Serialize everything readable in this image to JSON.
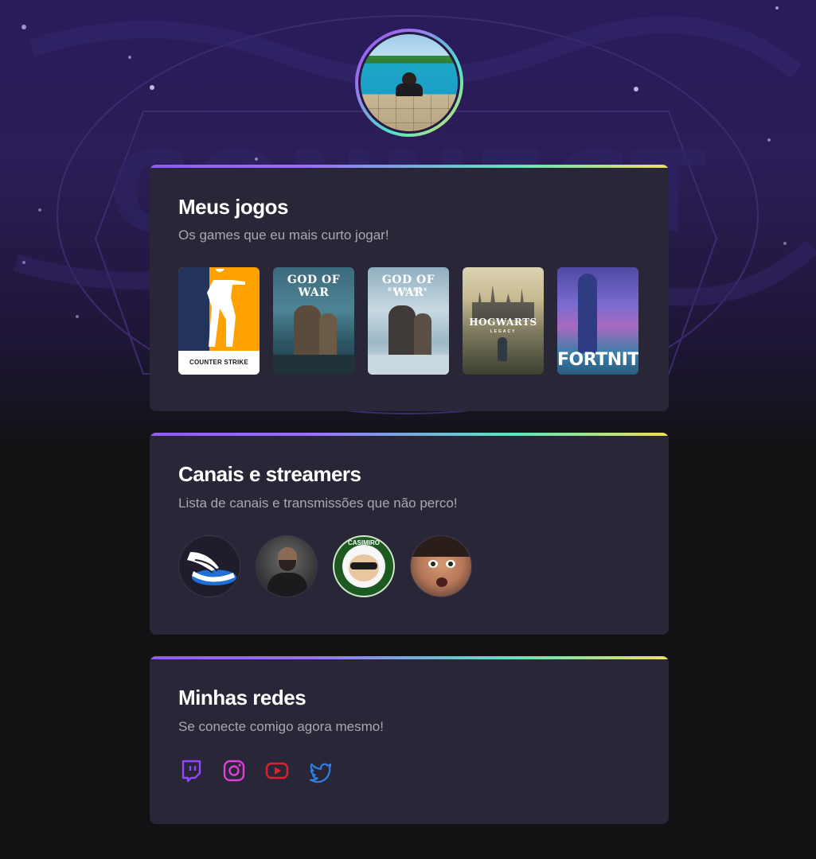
{
  "profile": {
    "avatar_icon": "profile-photo-pool"
  },
  "games_section": {
    "title": "Meus jogos",
    "subtitle": "Os games que eu mais curto jogar!",
    "games": [
      {
        "name": "COUNTER STRIKE",
        "icon": "counter-strike-cover"
      },
      {
        "name": "GOD OF WAR",
        "icon": "god-of-war-cover"
      },
      {
        "name": "GOD OF WAR",
        "subtitle": "RAGNARÖK",
        "icon": "god-of-war-ragnarok-cover"
      },
      {
        "name": "HOGWARTS",
        "subtitle": "LEGACY",
        "icon": "hogwarts-legacy-cover"
      },
      {
        "name": "FORTNITE",
        "icon": "fortnite-cover"
      }
    ]
  },
  "channels_section": {
    "title": "Canais e streamers",
    "subtitle": "Lista de canais e transmissões que não perco!",
    "channels": [
      {
        "icon": "winged-shoe-logo"
      },
      {
        "icon": "streamer-photo"
      },
      {
        "name": "CASIMIRO",
        "icon": "casimiro-logo"
      },
      {
        "icon": "streamer-face"
      }
    ]
  },
  "socials_section": {
    "title": "Minhas redes",
    "subtitle": "Se conecte comigo agora mesmo!",
    "links": [
      {
        "icon": "twitch-icon",
        "color": "#9146ff"
      },
      {
        "icon": "instagram-icon",
        "color": "#e03ed8"
      },
      {
        "icon": "youtube-icon",
        "color": "#e0202a"
      },
      {
        "icon": "twitter-icon",
        "color": "#2d7fe6"
      }
    ]
  },
  "theme": {
    "accent_gradient": [
      "#8f5cf6",
      "#5be6bd",
      "#f1de5c"
    ],
    "card_bg": "#292637",
    "text_muted": "#a8a8b3"
  }
}
